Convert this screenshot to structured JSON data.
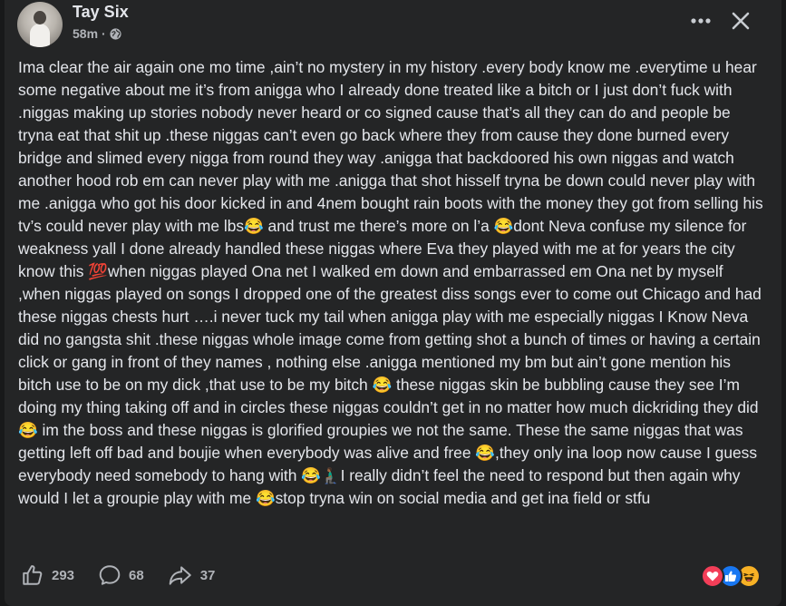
{
  "post": {
    "author": "Tay Six",
    "time": "58m",
    "separator": "·",
    "privacy_icon": "globe-icon",
    "body": "Ima clear the air again one mo time ,ain’t no mystery in my history .every body know me .everytime u hear some negative about me it’s from anigga who I already done treated like a bitch or I just don’t fuck with .niggas making up stories nobody never heard or co signed cause that’s all they can do and people be tryna eat that shit up .these niggas can’t even go back where they from cause they done burned every bridge and slimed every nigga from round they way .anigga that backdoored his own niggas and watch another hood rob em can never play with me .anigga that shot hisself tryna be down could never play with me .anigga who got his door kicked in and 4nem bought rain boots with the money they got from selling his tv’s could never play with me lbs😂 and trust me there’s more on l’a 😂dont Neva confuse my silence for weakness yall I done already handled these niggas where Eva they played with me at for years the city know this 💯when niggas played Ona net I walked em down and embarrassed em Ona net by myself ,when niggas played on songs I dropped one of the greatest diss songs ever to come out Chicago and had these niggas chests hurt ….i never tuck my tail when anigga play with me especially niggas I Know Neva did no gangsta shit .these niggas whole image come from getting shot a bunch of times or having a certain click or gang in front of they names , nothing else .anigga mentioned my bm but ain’t gone mention his bitch use to be on my dick ,that use to be my bitch 😂 these niggas skin be bubbling cause they see I’m doing my thing taking off and in circles these niggas couldn’t get in no matter how much dickriding they did 😂 im the boss and these niggas is glorified groupies we not the same. These the same niggas that was getting left off bad and boujie when everybody was alive and free 😂,they only ina loop now cause I guess everybody need somebody to hang with 😂🧎🏾‍♂️I really didn’t feel the need to respond but then again why would I let a groupie play with me 😂stop tryna win on social media and get ina field or stfu"
  },
  "actions": {
    "likes": "293",
    "comments": "68",
    "shares": "37"
  },
  "reactions": [
    "love-icon",
    "like-icon",
    "haha-icon"
  ],
  "colors": {
    "background": "#242526",
    "text": "#e4e6eb",
    "secondary": "#b0b3b8",
    "love": "#f33e58",
    "like": "#1877f2",
    "haha": "#f7b125"
  }
}
